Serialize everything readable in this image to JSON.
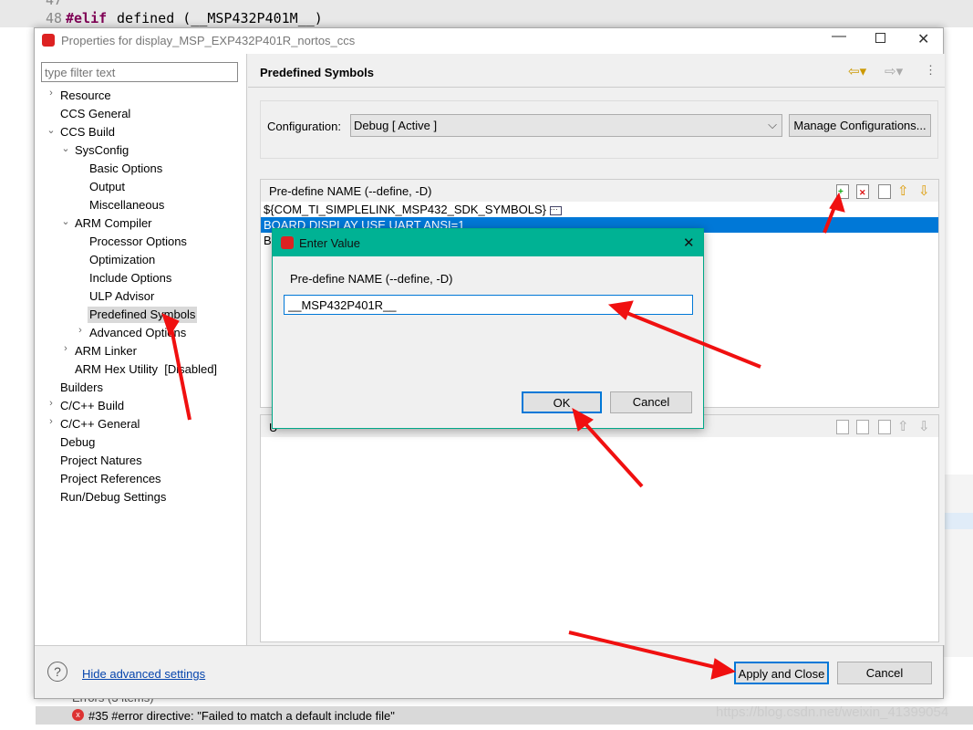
{
  "editor": {
    "line47": "47",
    "line48": "48",
    "keyword": "#elif",
    "code": " defined (__MSP432P401M__)"
  },
  "dialog": {
    "title": "Properties for display_MSP_EXP432P401R_nortos_ccs",
    "filter_placeholder": "type filter text",
    "tree": [
      {
        "label": "Resource",
        "level": 0,
        "expander": "collapsed"
      },
      {
        "label": "CCS General",
        "level": 0,
        "expander": "none"
      },
      {
        "label": "CCS Build",
        "level": 0,
        "expander": "expanded"
      },
      {
        "label": "SysConfig",
        "level": 1,
        "expander": "expanded"
      },
      {
        "label": "Basic Options",
        "level": 2,
        "expander": "none"
      },
      {
        "label": "Output",
        "level": 2,
        "expander": "none"
      },
      {
        "label": "Miscellaneous",
        "level": 2,
        "expander": "none"
      },
      {
        "label": "ARM Compiler",
        "level": 1,
        "expander": "expanded"
      },
      {
        "label": "Processor Options",
        "level": 2,
        "expander": "none"
      },
      {
        "label": "Optimization",
        "level": 2,
        "expander": "none"
      },
      {
        "label": "Include Options",
        "level": 2,
        "expander": "none"
      },
      {
        "label": "ULP Advisor",
        "level": 2,
        "expander": "none"
      },
      {
        "label": "Predefined Symbols",
        "level": 2,
        "expander": "none",
        "selected": true
      },
      {
        "label": "Advanced Options",
        "level": 2,
        "expander": "collapsed"
      },
      {
        "label": "ARM Linker",
        "level": 1,
        "expander": "collapsed"
      },
      {
        "label": "ARM Hex Utility  [Disabled]",
        "level": 1,
        "expander": "none"
      },
      {
        "label": "Builders",
        "level": 0,
        "expander": "none"
      },
      {
        "label": "C/C++ Build",
        "level": 0,
        "expander": "collapsed"
      },
      {
        "label": "C/C++ General",
        "level": 0,
        "expander": "collapsed"
      },
      {
        "label": "Debug",
        "level": 0,
        "expander": "none"
      },
      {
        "label": "Project Natures",
        "level": 0,
        "expander": "none"
      },
      {
        "label": "Project References",
        "level": 0,
        "expander": "none"
      },
      {
        "label": "Run/Debug Settings",
        "level": 0,
        "expander": "none"
      }
    ],
    "page_title": "Predefined Symbols",
    "config_label": "Configuration:",
    "config_value": "Debug  [ Active ]",
    "manage_button": "Manage Configurations...",
    "define_header": "Pre-define NAME (--define, -D)",
    "define_rows": [
      "${COM_TI_SIMPLELINK_MSP432_SDK_SYMBOLS}",
      "BOARD DISPLAY USE UART ANSI=1",
      "BO"
    ],
    "undefine_header": "U",
    "help_link": "Hide advanced settings",
    "apply_button": "Apply and Close",
    "cancel_button": "Cancel"
  },
  "modal": {
    "title": "Enter Value",
    "label": "Pre-define NAME (--define, -D)",
    "value": "__MSP432P401R__",
    "ok": "OK",
    "cancel": "Cancel"
  },
  "problems": {
    "group": "Errors (3 items)",
    "error1": "#35 #error directive: \"Failed to match a default include file\""
  },
  "watermark": "https://blog.csdn.net/weixin_41399054",
  "colors": {
    "selection": "#0078d7",
    "modal_title": "#00b294",
    "arrow": "#f01010"
  }
}
